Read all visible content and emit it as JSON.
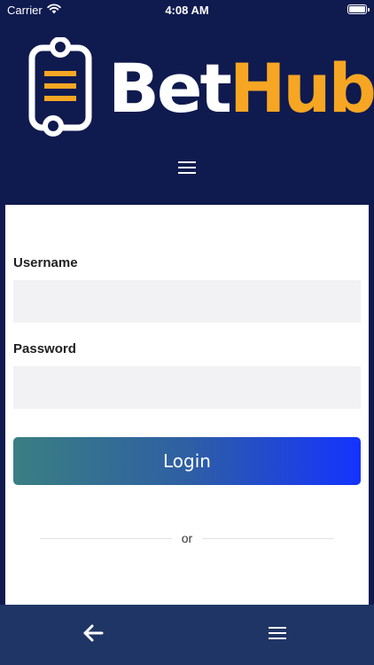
{
  "status_bar": {
    "carrier": "Carrier",
    "time": "4:08 AM"
  },
  "header": {
    "logo_part1": "Bet",
    "logo_part2": "Hub",
    "logo_colors": {
      "bet": "#ffffff",
      "hub": "#f6a623",
      "background": "#0f1a4f"
    },
    "menu_icon": "hamburger-icon"
  },
  "login_form": {
    "username_label": "Username",
    "username_value": "",
    "password_label": "Password",
    "password_value": "",
    "login_button": "Login",
    "divider_text": "or"
  },
  "bottom_bar": {
    "back_icon": "arrow-left-icon",
    "menu_icon": "hamburger-icon",
    "background": "#1f3565"
  }
}
